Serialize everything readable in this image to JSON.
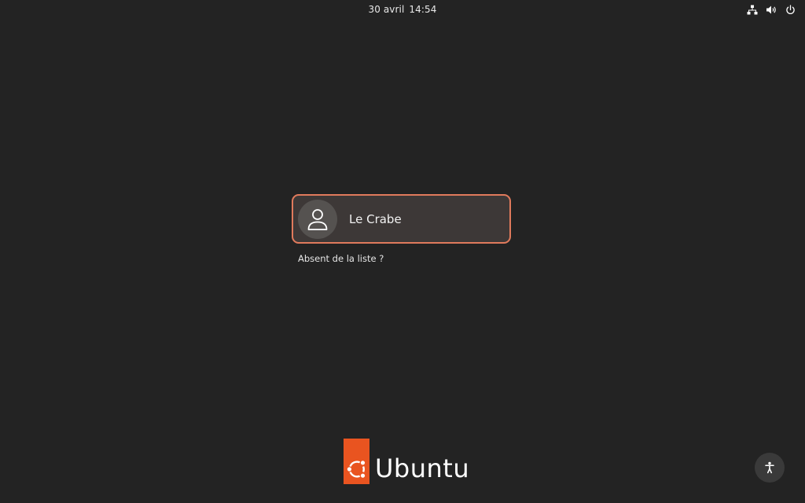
{
  "topbar": {
    "date": "30 avril",
    "time": "14:54",
    "icons": [
      "network-icon",
      "volume-icon",
      "power-icon"
    ]
  },
  "login": {
    "user_name": "Le Crabe",
    "not_listed_label": "Absent de la liste ?"
  },
  "branding": {
    "logo_text": "Ubuntu",
    "brand_color": "#e95420"
  },
  "colors": {
    "background": "#232323",
    "card_border": "#e07a5c",
    "card_background": "#3d3837"
  },
  "footer": {
    "accessibility_icon": "accessibility-icon"
  }
}
